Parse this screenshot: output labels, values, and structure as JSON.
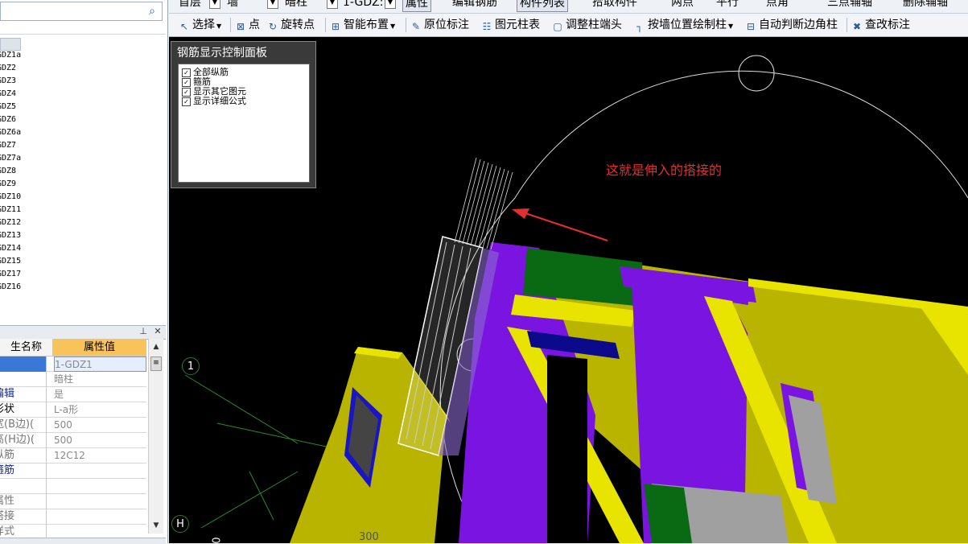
{
  "left_panel": {
    "tree_items": [
      "GDZ1a",
      "GDZ2",
      "GDZ3",
      "GDZ4",
      "GDZ5",
      "GDZ6",
      "GDZ6a",
      "GDZ7",
      "GDZ7a",
      "GDZ8",
      "GDZ9",
      "GDZ10",
      "GDZ11",
      "GDZ12",
      "GDZ13",
      "GDZ14",
      "GDZ15",
      "GDZ17",
      "GDZ16"
    ],
    "properties": {
      "col_name": "生名称",
      "col_value": "属性值",
      "rows": [
        {
          "name": "",
          "value": "1-GDZ1",
          "name_color": "#000",
          "selected": true
        },
        {
          "name": "",
          "value": "暗柱",
          "name_color": "#000"
        },
        {
          "name": "编辑",
          "value": "是",
          "name_color": "#1a2a8a"
        },
        {
          "name": "形状",
          "value": "L-a形",
          "name_color": "#000"
        },
        {
          "name": "宽(B边)(",
          "value": "500",
          "name_color": "#777"
        },
        {
          "name": "高(H边)(",
          "value": "500",
          "name_color": "#777"
        },
        {
          "name": "纵筋",
          "value": "12C12",
          "name_color": "#777"
        },
        {
          "name": "箍筋",
          "value": "",
          "name_color": "#1a2a8a"
        },
        {
          "name": "",
          "value": "",
          "name_color": "#000"
        },
        {
          "name": "属性",
          "value": "",
          "name_color": "#777"
        },
        {
          "name": "搭接",
          "value": "",
          "name_color": "#777"
        },
        {
          "name": "样式",
          "value": "",
          "name_color": "#777"
        }
      ]
    }
  },
  "toolbar_top": {
    "floor": "首层",
    "type": "墙",
    "subtype": "暗柱",
    "component": "1-GDZ:",
    "property": "属性",
    "edit_rebar": "编辑钢筋",
    "component_list": "构件列表",
    "pick": "拾取构件",
    "two_points": "两点",
    "parallel": "平行",
    "point_angle": "点角",
    "three_point_axis": "三点辅轴",
    "delete_axis": "删除辅轴"
  },
  "toolbar_main": {
    "select": "选择",
    "point": "点",
    "rotate_point": "旋转点",
    "smart_layout": "智能布置",
    "original_mark": "原位标注",
    "element_table": "图元柱表",
    "adjust_end": "调整柱端头",
    "by_wall": "按墙位置绘制柱",
    "auto_corner": "自动判断边角柱",
    "check_mark": "查改标注"
  },
  "rebar_panel": {
    "title": "钢筋显示控制面板",
    "options": [
      {
        "label": "全部纵筋",
        "checked": true
      },
      {
        "label": "箍筋",
        "checked": true
      },
      {
        "label": "显示其它图元",
        "checked": true
      },
      {
        "label": "显示详细公式",
        "checked": true
      }
    ]
  },
  "viewport": {
    "annotation": "这就是伸入的搭接的",
    "axis_1": "1",
    "axis_h": "H",
    "dim_300": "300",
    "dim_0": "0",
    "colors": {
      "wall_yellow": "#b8b400",
      "wall_bright": "#e8e400",
      "column_purple": "#7a14e0",
      "beam_green": "#0a6a14",
      "grey": "#a0a0a0",
      "annotation_red": "#e03030"
    }
  }
}
